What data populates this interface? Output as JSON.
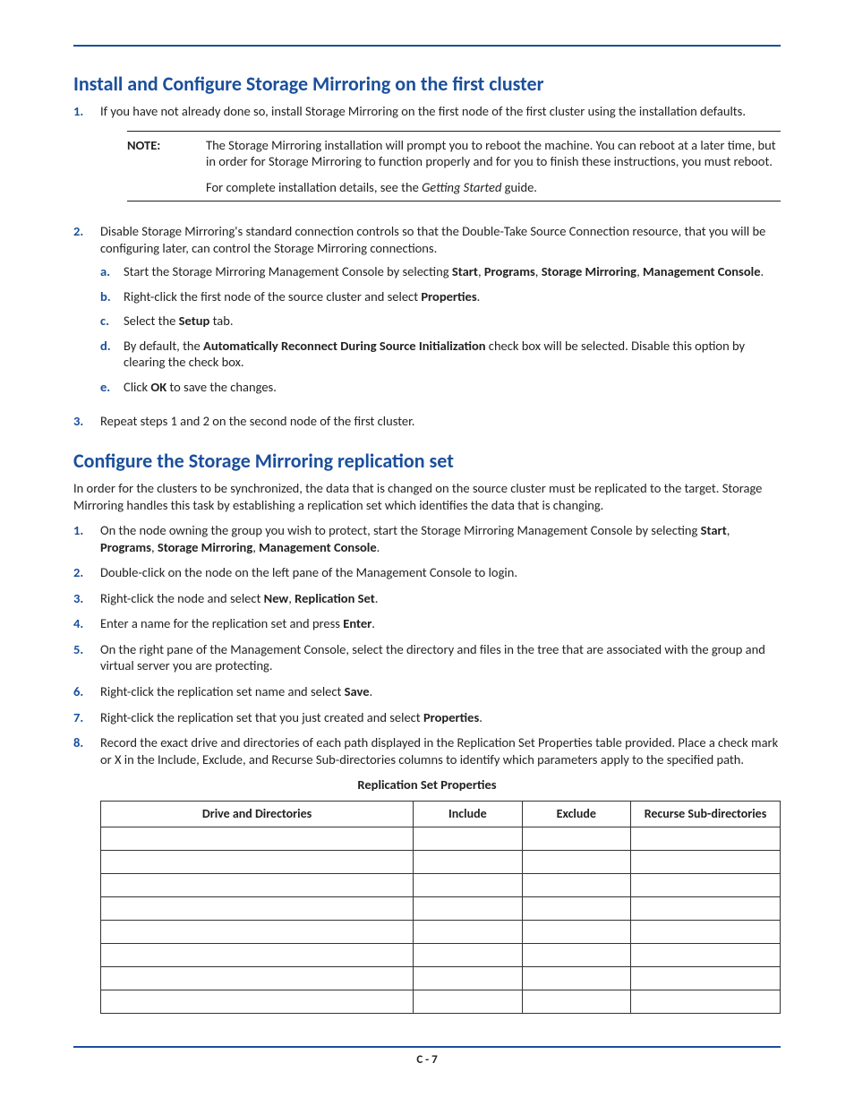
{
  "section1": {
    "title": "Install and Configure Storage Mirroring on the first cluster",
    "step1": {
      "num": "1.",
      "text": "If you have not already done so, install Storage Mirroring on the first node of the first cluster using the installation defaults."
    },
    "note": {
      "label": "NOTE:",
      "p1": "The Storage Mirroring installation will prompt you to reboot the machine. You can reboot at a later time, but in order for Storage Mirroring to function properly and for you to finish these instructions, you must reboot.",
      "p2_pre": "For complete installation details, see the ",
      "p2_italic": "Getting Started",
      "p2_post": " guide."
    },
    "step2": {
      "num": "2.",
      "text": "Disable Storage Mirroring's standard connection controls so that the Double-Take Source Connection resource, that you will be configuring later, can control the Storage Mirroring connections.",
      "a": {
        "m": "a.",
        "pre": "Start the Storage Mirroring Management Console by selecting ",
        "b1": "Start",
        "s1": ", ",
        "b2": "Programs",
        "s2": ", ",
        "b3": "Storage Mirroring",
        "s3": ", ",
        "b4": "Management Console",
        "post": "."
      },
      "b": {
        "m": "b.",
        "pre": "Right-click the first node of the source cluster and select ",
        "b1": "Properties",
        "post": "."
      },
      "c": {
        "m": "c.",
        "pre": "Select the ",
        "b1": "Setup",
        "post": " tab."
      },
      "d": {
        "m": "d.",
        "pre": "By default, the ",
        "b1": "Automatically Reconnect During Source Initialization",
        "post": " check box will be selected. Disable this option by clearing the check box."
      },
      "e": {
        "m": "e.",
        "pre": "Click ",
        "b1": "OK",
        "post": " to save the changes."
      }
    },
    "step3": {
      "num": "3.",
      "text": "Repeat steps 1 and 2 on the second node of the first cluster."
    }
  },
  "section2": {
    "title": "Configure the Storage Mirroring replication set",
    "intro": "In order for the clusters to be synchronized, the data that is changed on the source cluster must be replicated to the target. Storage Mirroring handles this task by establishing a replication set which identifies the data that is changing.",
    "s1": {
      "num": "1.",
      "pre": "On the node owning the group you wish to protect, start the Storage Mirroring Management Console by selecting ",
      "b1": "Start",
      "s1": ", ",
      "b2": "Programs",
      "s2": ", ",
      "b3": "Storage Mirroring",
      "s3": ", ",
      "b4": "Management Console",
      "post": "."
    },
    "s2": {
      "num": "2.",
      "text": "Double-click on the node on the left pane of the Management Console to login."
    },
    "s3": {
      "num": "3.",
      "pre": "Right-click the node and select ",
      "b1": "New",
      "s1": ", ",
      "b2": "Replication Set",
      "post": "."
    },
    "s4": {
      "num": "4.",
      "pre": "Enter a name for the replication set and press ",
      "b1": "Enter",
      "post": "."
    },
    "s5": {
      "num": "5.",
      "text": "On the right pane of the Management Console, select the directory and files in the tree that are associated with the group and virtual server you are protecting."
    },
    "s6": {
      "num": "6.",
      "pre": "Right-click the replication set name and select ",
      "b1": "Save",
      "post": "."
    },
    "s7": {
      "num": "7.",
      "pre": "Right-click the replication set that you just created and select ",
      "b1": "Properties",
      "post": "."
    },
    "s8": {
      "num": "8.",
      "text": "Record the exact drive and directories of each path displayed in the Replication Set Properties table provided. Place a check mark or X in the Include, Exclude, and Recurse Sub-directories columns to identify which parameters apply to the specified path."
    }
  },
  "table": {
    "caption": "Replication Set Properties",
    "h1": "Drive and Directories",
    "h2": "Include",
    "h3": "Exclude",
    "h4": "Recurse Sub-directories"
  },
  "footer": {
    "page": "C - 7"
  }
}
